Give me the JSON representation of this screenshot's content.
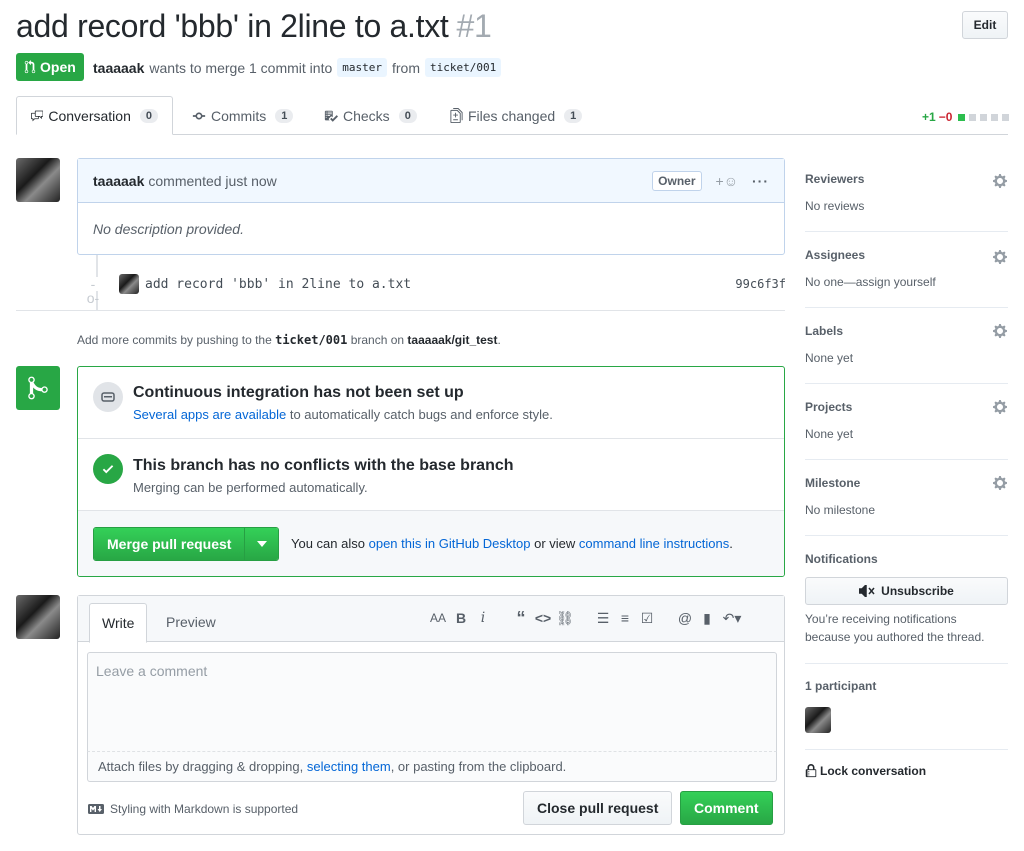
{
  "pr": {
    "title": "add record 'bbb' in 2line to a.txt",
    "number": "#1",
    "edit_label": "Edit",
    "state": "Open",
    "author": "taaaaak",
    "merge_text_1": "wants to merge 1 commit into",
    "base_branch": "master",
    "from_text": "from",
    "head_branch": "ticket/001"
  },
  "tabs": [
    {
      "label": "Conversation",
      "count": "0",
      "icon": "comment-icon"
    },
    {
      "label": "Commits",
      "count": "1",
      "icon": "commit-icon"
    },
    {
      "label": "Checks",
      "count": "0",
      "icon": "checklist-icon"
    },
    {
      "label": "Files changed",
      "count": "1",
      "icon": "diff-icon"
    }
  ],
  "diffstat": {
    "added": "+1",
    "removed": "−0"
  },
  "comment": {
    "author": "taaaaak",
    "action": "commented just now",
    "badge": "Owner",
    "body": "No description provided."
  },
  "commit": {
    "message": "add record 'bbb' in 2line to a.txt",
    "sha": "99c6f3f"
  },
  "push_note": {
    "prefix": "Add more commits by pushing to the",
    "branch": "ticket/001",
    "middle": "branch on",
    "repo": "taaaaak/git_test",
    "suffix": "."
  },
  "merge": {
    "ci_title": "Continuous integration has not been set up",
    "ci_link": "Several apps are available",
    "ci_text": "to automatically catch bugs and enforce style.",
    "ok_title": "This branch has no conflicts with the base branch",
    "ok_text": "Merging can be performed automatically.",
    "merge_button": "Merge pull request",
    "also_text": "You can also",
    "desktop_link": "open this in GitHub Desktop",
    "or_text": "or view",
    "cli_link": "command line instructions",
    "period": "."
  },
  "form": {
    "write_tab": "Write",
    "preview_tab": "Preview",
    "placeholder": "Leave a comment",
    "attach_prefix": "Attach files by dragging & dropping,",
    "attach_link": "selecting them",
    "attach_suffix": ", or pasting from the clipboard.",
    "markdown_note": "Styling with Markdown is supported",
    "close_button": "Close pull request",
    "comment_button": "Comment"
  },
  "sidebar": {
    "reviewers": {
      "title": "Reviewers",
      "value": "No reviews"
    },
    "assignees": {
      "title": "Assignees",
      "value": "No one—assign yourself"
    },
    "labels": {
      "title": "Labels",
      "value": "None yet"
    },
    "projects": {
      "title": "Projects",
      "value": "None yet"
    },
    "milestone": {
      "title": "Milestone",
      "value": "No milestone"
    },
    "notifications": {
      "title": "Notifications",
      "button": "Unsubscribe",
      "reason_1": "You’re receiving notifications",
      "reason_2": "because you authored the thread."
    },
    "participants": "1 participant",
    "lock": "Lock conversation"
  },
  "colors": {
    "green": "#28a745",
    "link": "#0366d6",
    "red": "#cb2431"
  }
}
